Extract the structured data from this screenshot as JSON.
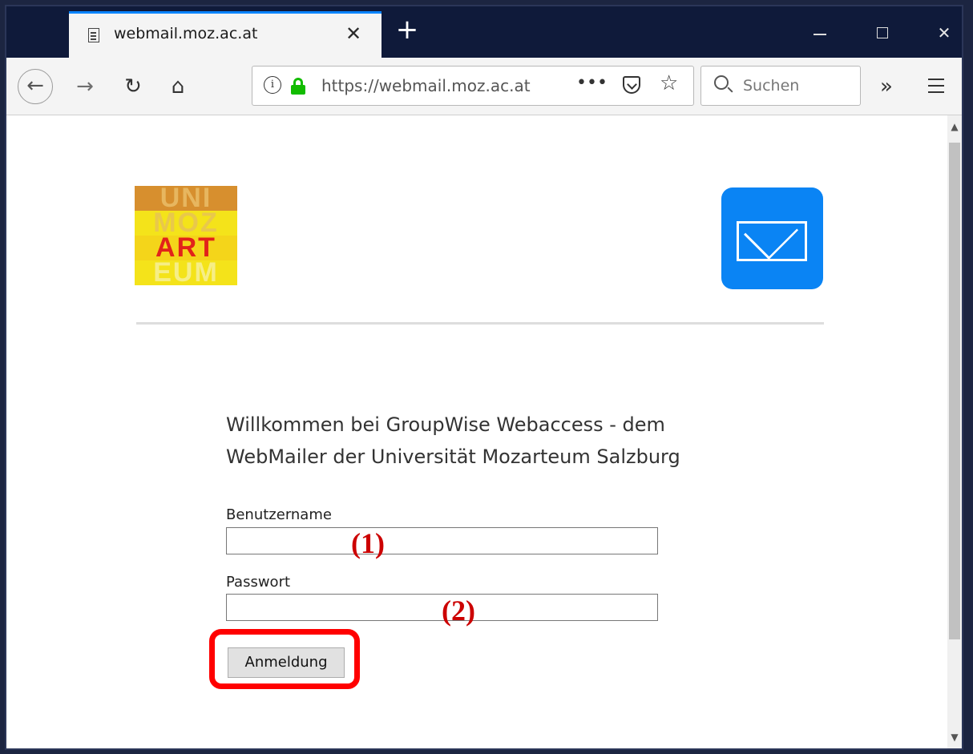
{
  "browser": {
    "tab": {
      "title": "webmail.moz.ac.at",
      "close_glyph": "✕"
    },
    "new_tab_glyph": "+",
    "window_controls": {
      "close_glyph": "✕"
    },
    "nav": {
      "back_glyph": "←",
      "forward_glyph": "→",
      "reload_glyph": "↻",
      "home_glyph": "⌂"
    },
    "url": {
      "text": "https://webmail.moz.ac.at",
      "more_glyph": "•••",
      "star_glyph": "☆",
      "info_glyph": "i"
    },
    "search": {
      "placeholder": "Suchen"
    },
    "overflow_glyph": "»"
  },
  "page": {
    "logo": {
      "rows": [
        "UNI",
        "MOZ",
        "ART",
        "EUM"
      ]
    },
    "welcome": {
      "line1": "Willkommen bei GroupWise Webaccess - dem",
      "line2": "WebMailer der Universität Mozarteum Salzburg"
    },
    "form": {
      "username_label": "Benutzername",
      "username_value": "",
      "password_label": "Passwort",
      "password_value": "",
      "submit_label": "Anmeldung"
    },
    "annotations": {
      "mark1": "(1)",
      "mark2": "(2)"
    }
  },
  "colors": {
    "accent": "#0a84ff",
    "lock_green": "#12bc00",
    "mail_tile": "#0a84f4",
    "annotation_red": "#ff0000"
  },
  "icons": [
    "page-icon",
    "close-icon",
    "plus-icon",
    "minimize-icon",
    "maximize-icon",
    "back-icon",
    "forward-icon",
    "reload-icon",
    "home-icon",
    "info-icon",
    "lock-icon",
    "more-icon",
    "pocket-icon",
    "star-icon",
    "search-icon",
    "overflow-icon",
    "menu-icon",
    "mail-icon"
  ]
}
